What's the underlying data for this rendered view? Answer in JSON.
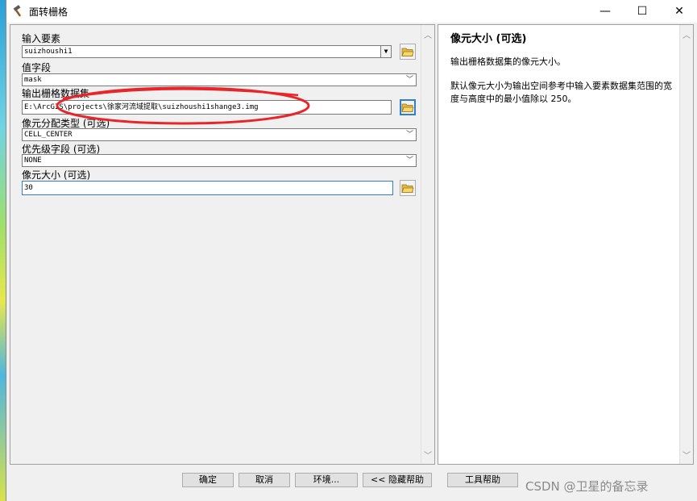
{
  "window": {
    "title": "面转栅格",
    "controls": {
      "minimize": "—",
      "maximize": "☐",
      "close": "✕"
    }
  },
  "form": {
    "input_features": {
      "label": "输入要素",
      "value": "suizhoushi1"
    },
    "value_field": {
      "label": "值字段",
      "value": "mask"
    },
    "output_raster": {
      "label": "输出栅格数据集",
      "value": "E:\\ArcGIS\\projects\\徐家河流域提取\\suizhoushi1shange3.img"
    },
    "cell_assignment": {
      "label": "像元分配类型 (可选)",
      "value": "CELL_CENTER"
    },
    "priority_field": {
      "label": "优先级字段 (可选)",
      "value": "NONE"
    },
    "cell_size": {
      "label": "像元大小 (可选)",
      "value": "30"
    }
  },
  "help": {
    "title": "像元大小 (可选)",
    "paragraph1": "输出栅格数据集的像元大小。",
    "paragraph2": "默认像元大小为输出空间参考中输入要素数据集范围的宽度与高度中的最小值除以 250。"
  },
  "buttons": {
    "ok": "确定",
    "cancel": "取消",
    "environments": "环境...",
    "hide_help": "<< 隐藏帮助",
    "tool_help": "工具帮助"
  },
  "watermark": "CSDN @卫星的备忘录",
  "colors": {
    "annotation": "#e8262a",
    "focus": "#2f7fd1",
    "folder": "#e6b93c"
  },
  "icons": {
    "title": "hammer-icon",
    "browse": "folder-open-icon"
  }
}
